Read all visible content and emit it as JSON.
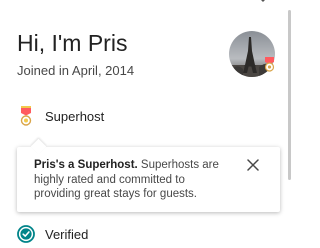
{
  "profile": {
    "greeting": "Hi, I'm Pris",
    "joined": "Joined in April, 2014",
    "avatar_icon": "profile-photo-eiffel-tower"
  },
  "badges": {
    "superhost": {
      "label": "Superhost",
      "icon": "superhost-medal-icon"
    },
    "verified": {
      "label": "Verified",
      "icon": "verified-check-icon"
    }
  },
  "tooltip": {
    "title": "Pris's a Superhost.",
    "body": " Superhosts are highly rated and committed to providing great stays for guests.",
    "close_icon": "close-icon"
  },
  "colors": {
    "accent": "#ff5a5f",
    "verified": "#008489",
    "text_primary": "#222222",
    "text_secondary": "#484848"
  }
}
